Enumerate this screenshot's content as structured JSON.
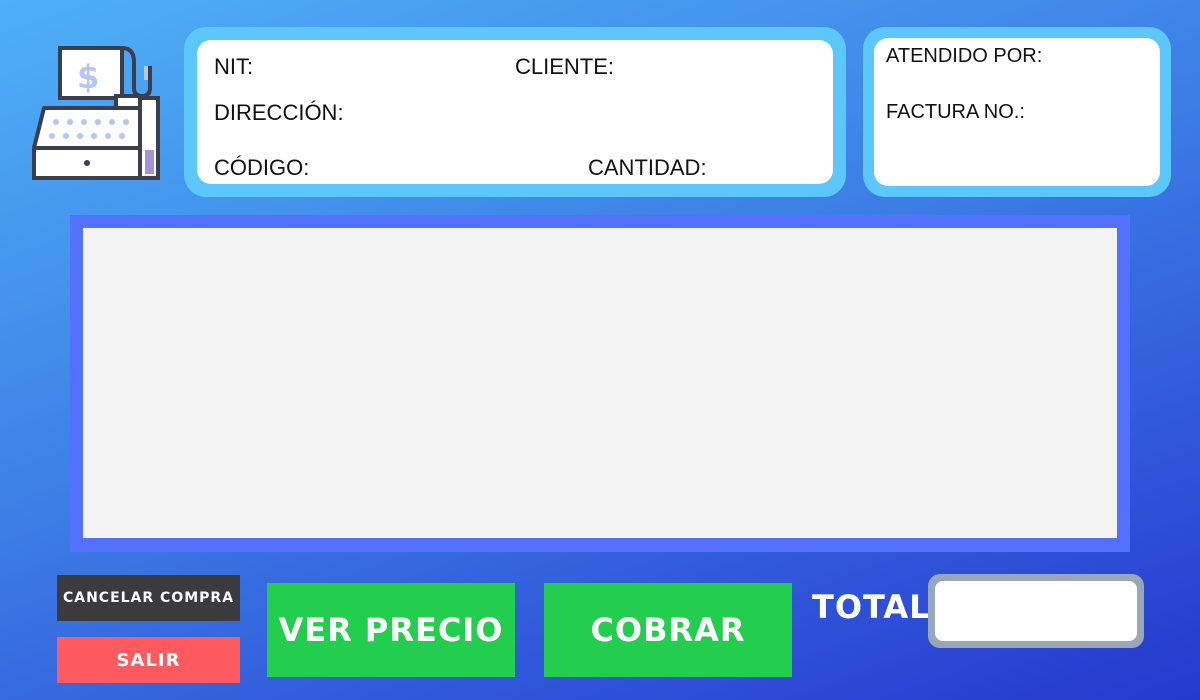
{
  "icons": {
    "register": "cash-register-icon"
  },
  "customer_panel": {
    "nit_label": "NIT:",
    "client_label": "CLIENTE:",
    "address_label": "DIRECCIÓN:",
    "code_label": "CÓDIGO:",
    "quantity_label": "CANTIDAD:"
  },
  "staff_panel": {
    "attended_label": "ATENDIDO POR:",
    "invoice_label": "FACTURA NO.:"
  },
  "buttons": {
    "cancel": "CANCELAR COMPRA",
    "exit": "SALIR",
    "price": "VER PRECIO",
    "charge": "COBRAR"
  },
  "total": {
    "label": "TOTAL:",
    "value": ""
  },
  "colors": {
    "panel_border": "#5bc7fb",
    "items_frame": "#5370ff",
    "button_green": "#23cd4e",
    "button_red": "#ff5a5f",
    "button_dark": "#3b3b3d"
  }
}
